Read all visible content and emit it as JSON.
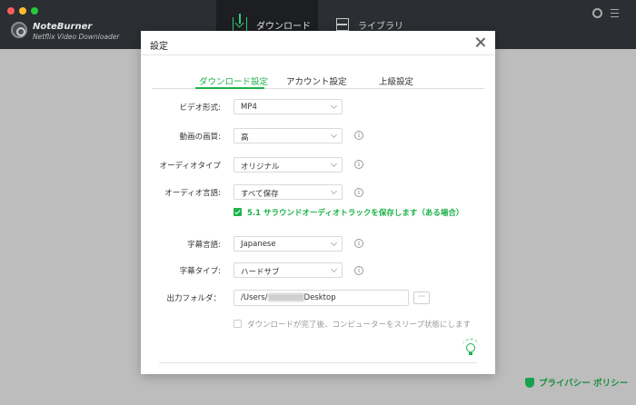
{
  "app": {
    "brand_name": "NoteBurner",
    "brand_sub": "Netflix Video Downloader",
    "tab_download": "ダウンロード",
    "tab_library": "ライブラリ"
  },
  "privacy": {
    "label": "プライバシー ポリシー"
  },
  "dialog": {
    "title": "設定",
    "tabs": [
      "ダウンロード設定",
      "アカウント設定",
      "上級設定"
    ],
    "active_tab": 0,
    "video_format": {
      "label": "ビデオ形式:",
      "value": "MP4"
    },
    "video_quality": {
      "label": "動画の画質:",
      "value": "高"
    },
    "audio_type": {
      "label": "オーディオタイプ",
      "value": "オリジナル"
    },
    "audio_language": {
      "label": "オーディオ言語:",
      "value": "すべて保存"
    },
    "surround": {
      "label": "5.1 サラウンドオーディオトラックを保存します（ある場合）",
      "checked": true
    },
    "subtitle_language": {
      "label": "字幕言語:",
      "value": "Japanese"
    },
    "subtitle_type": {
      "label": "字幕タイプ:",
      "value": "ハードサブ"
    },
    "output_folder": {
      "label": "出力フォルダ：",
      "prefix": "/Users/",
      "suffix": "Desktop",
      "browse": "···"
    },
    "sleep": {
      "label": "ダウンロードが完了後、コンピューターをスリープ状態にします",
      "checked": false
    },
    "info_glyph": "i"
  },
  "colors": {
    "accent": "#1db24a",
    "header_bg": "#2b2e33",
    "overlay": "#bdbdbd"
  }
}
